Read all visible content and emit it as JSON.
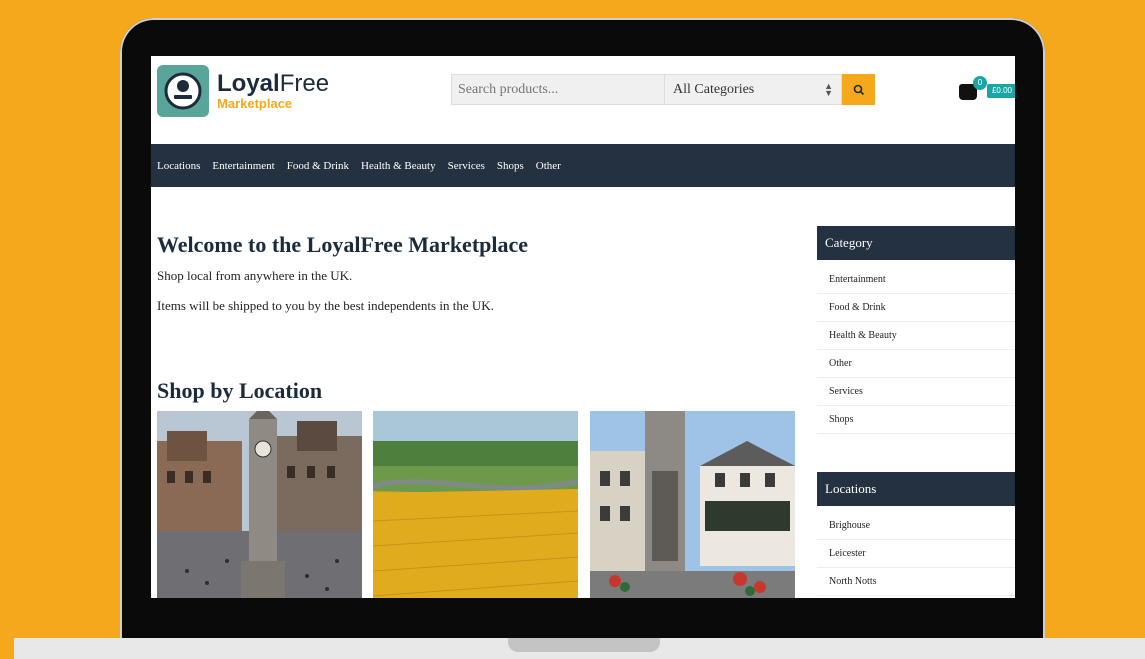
{
  "header": {
    "logo_main_bold": "Loyal",
    "logo_main_rest": "Free",
    "logo_sub": "Marketplace",
    "search_placeholder": "Search products...",
    "category_select": "All Categories",
    "cart_count": "0",
    "cart_total": "£0.00"
  },
  "nav": {
    "items": [
      "Locations",
      "Entertainment",
      "Food & Drink",
      "Health & Beauty",
      "Services",
      "Shops",
      "Other"
    ]
  },
  "main": {
    "welcome_title": "Welcome to the LoyalFree Marketplace",
    "welcome_line1": "Shop local from anywhere in the UK.",
    "welcome_line2": "Items will be shipped to you by the best independents in the UK.",
    "shop_by_location_title": "Shop by Location"
  },
  "sidebar": {
    "category_title": "Category",
    "categories": [
      "Entertainment",
      "Food & Drink",
      "Health & Beauty",
      "Other",
      "Services",
      "Shops"
    ],
    "locations_title": "Locations",
    "locations": [
      "Brighouse",
      "Leicester",
      "North Notts"
    ]
  },
  "colors": {
    "background": "#F5A81C",
    "nav_bg": "#233140",
    "accent": "#F5A81C",
    "cart_teal": "#1aa6a6",
    "logo_teal": "#5aa59a"
  }
}
